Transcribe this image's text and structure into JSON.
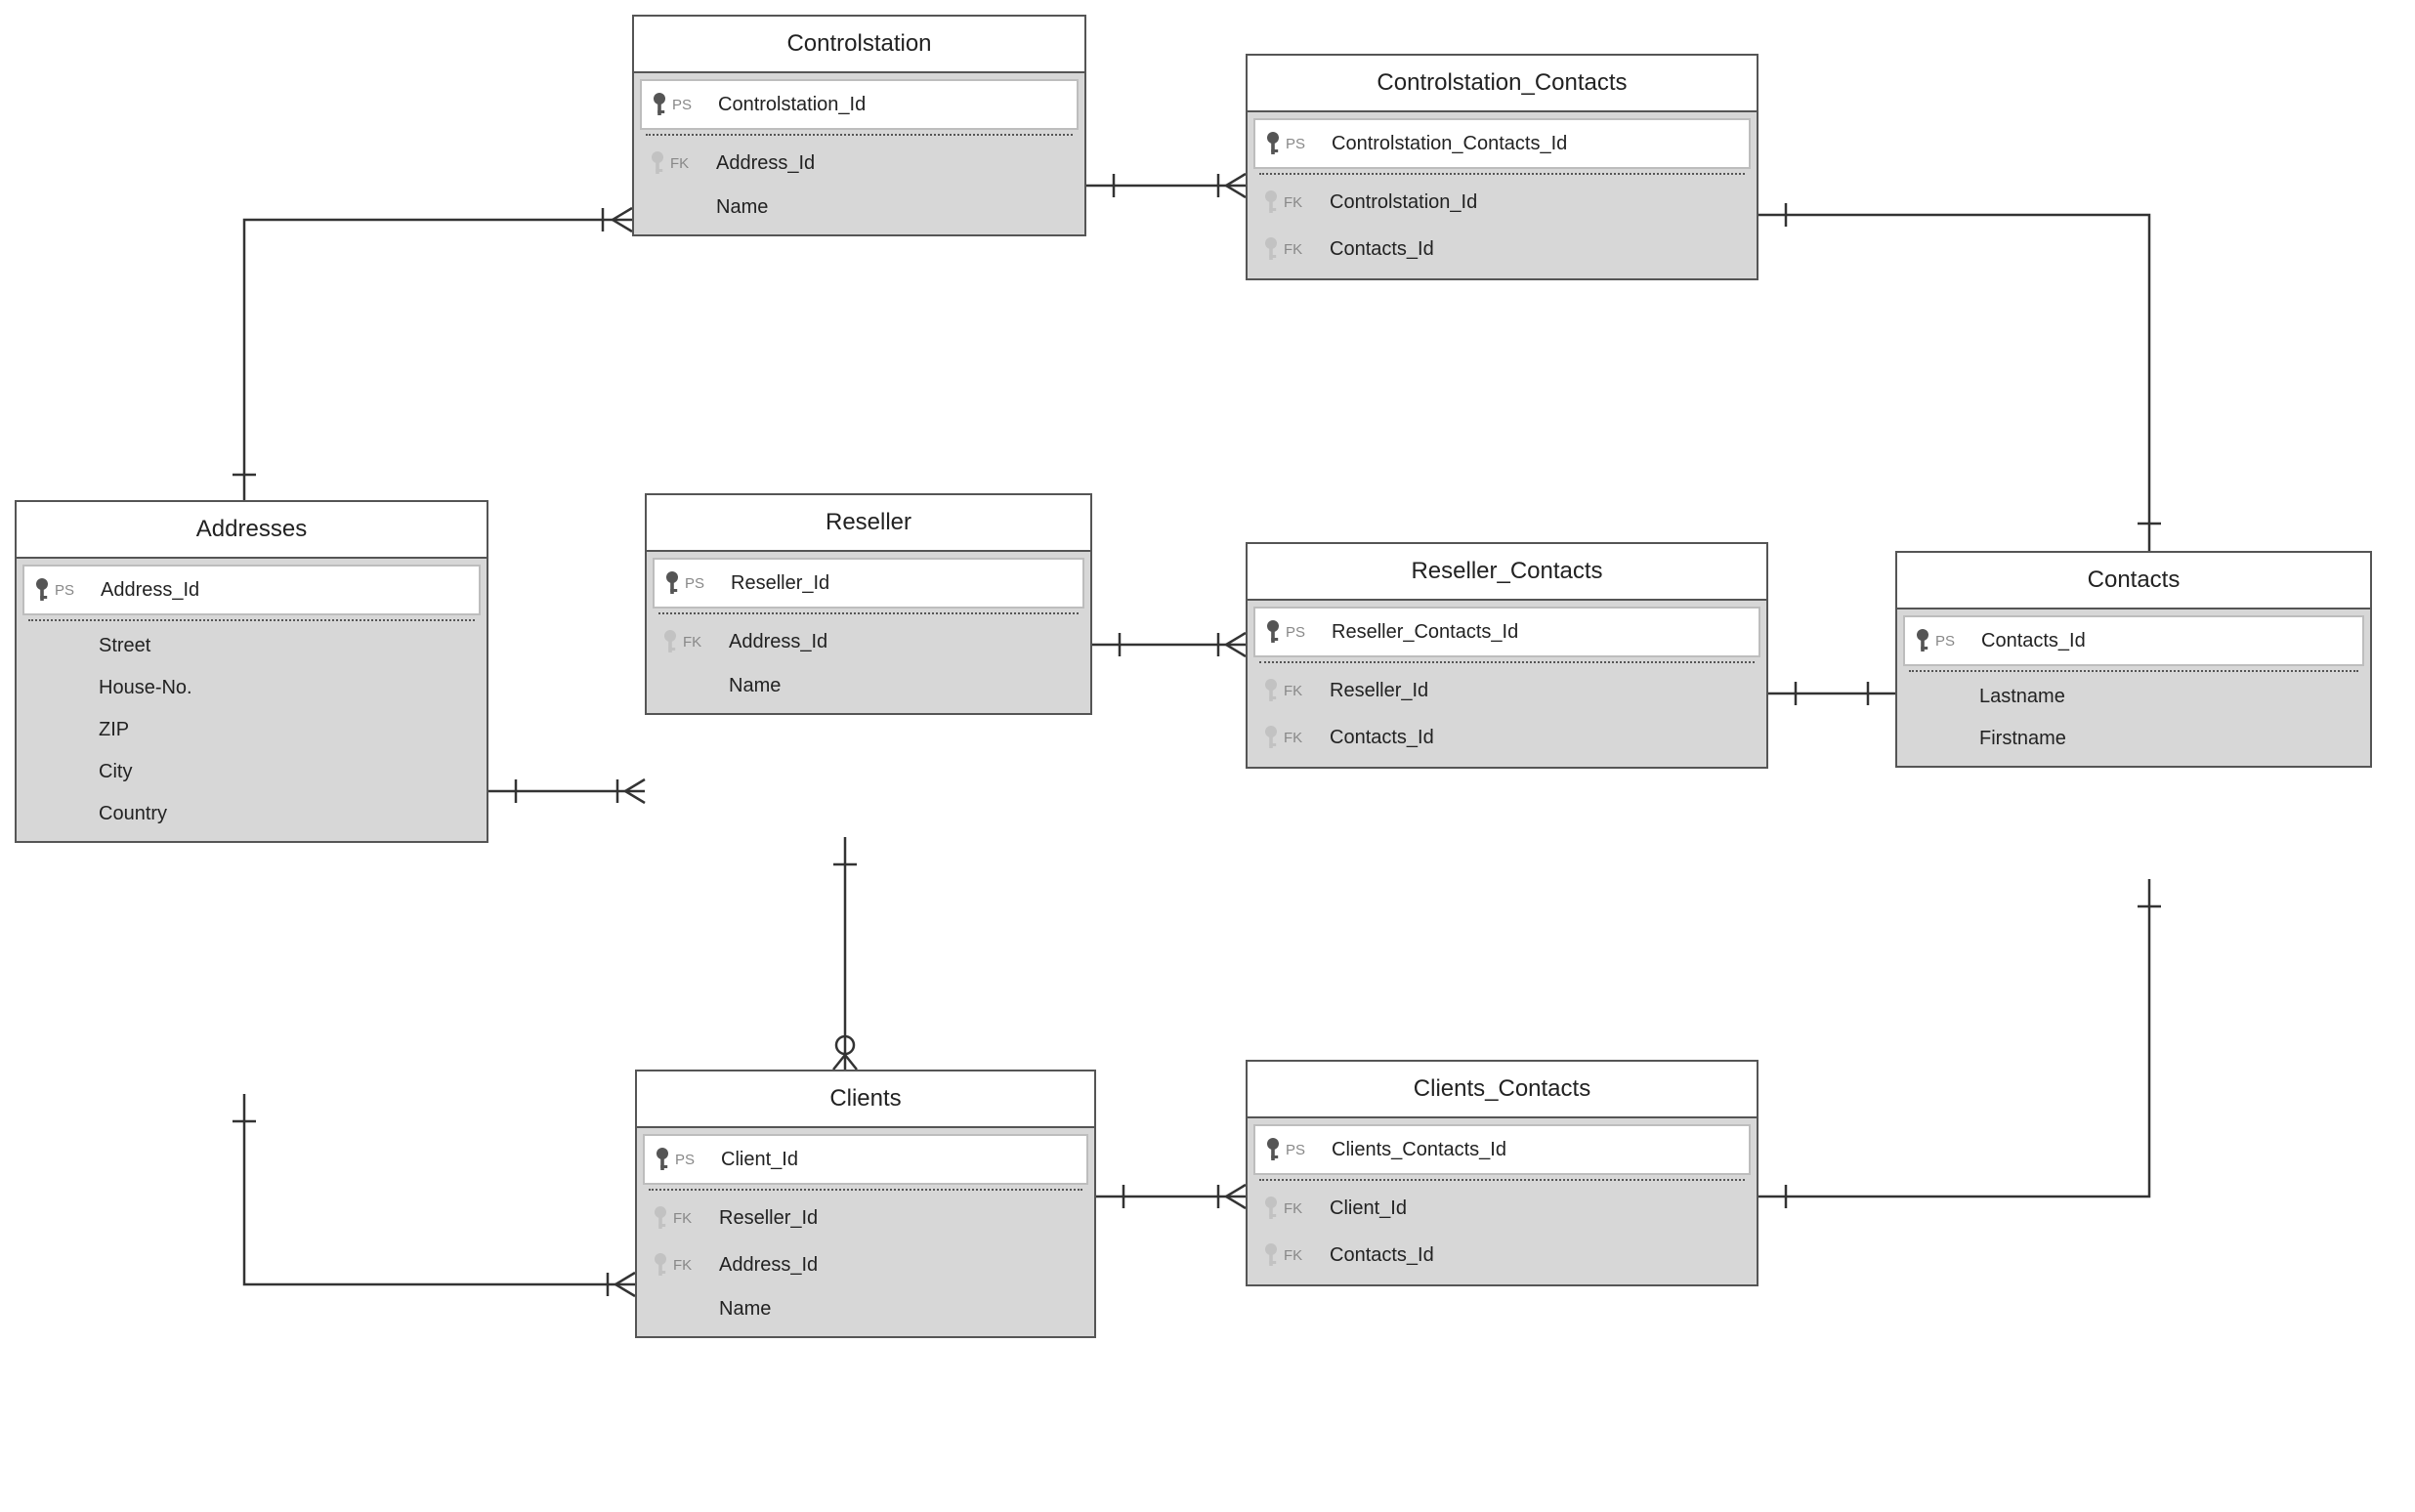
{
  "entities": {
    "controlstation": {
      "title": "Controlstation",
      "rows": [
        {
          "key": "PS",
          "label": "Controlstation_Id"
        },
        {
          "key": "FK",
          "label": "Address_Id"
        },
        {
          "key": "",
          "label": "Name"
        }
      ]
    },
    "controlstation_contacts": {
      "title": "Controlstation_Contacts",
      "rows": [
        {
          "key": "PS",
          "label": "Controlstation_Contacts_Id"
        },
        {
          "key": "FK",
          "label": "Controlstation_Id"
        },
        {
          "key": "FK",
          "label": "Contacts_Id"
        }
      ]
    },
    "addresses": {
      "title": "Addresses",
      "rows": [
        {
          "key": "PS",
          "label": "Address_Id"
        },
        {
          "key": "",
          "label": "Street"
        },
        {
          "key": "",
          "label": "House-No."
        },
        {
          "key": "",
          "label": "ZIP"
        },
        {
          "key": "",
          "label": "City"
        },
        {
          "key": "",
          "label": "Country"
        }
      ]
    },
    "reseller": {
      "title": "Reseller",
      "rows": [
        {
          "key": "PS",
          "label": "Reseller_Id"
        },
        {
          "key": "FK",
          "label": "Address_Id"
        },
        {
          "key": "",
          "label": "Name"
        }
      ]
    },
    "reseller_contacts": {
      "title": "Reseller_Contacts",
      "rows": [
        {
          "key": "PS",
          "label": "Reseller_Contacts_Id"
        },
        {
          "key": "FK",
          "label": "Reseller_Id"
        },
        {
          "key": "FK",
          "label": "Contacts_Id"
        }
      ]
    },
    "contacts": {
      "title": "Contacts",
      "rows": [
        {
          "key": "PS",
          "label": "Contacts_Id"
        },
        {
          "key": "",
          "label": "Lastname"
        },
        {
          "key": "",
          "label": "Firstname"
        }
      ]
    },
    "clients": {
      "title": "Clients",
      "rows": [
        {
          "key": "PS",
          "label": "Client_Id"
        },
        {
          "key": "FK",
          "label": "Reseller_Id"
        },
        {
          "key": "FK",
          "label": "Address_Id"
        },
        {
          "key": "",
          "label": "Name"
        }
      ]
    },
    "clients_contacts": {
      "title": "Clients_Contacts",
      "rows": [
        {
          "key": "PS",
          "label": "Clients_Contacts_Id"
        },
        {
          "key": "FK",
          "label": "Client_Id"
        },
        {
          "key": "FK",
          "label": "Contacts_Id"
        }
      ]
    }
  }
}
